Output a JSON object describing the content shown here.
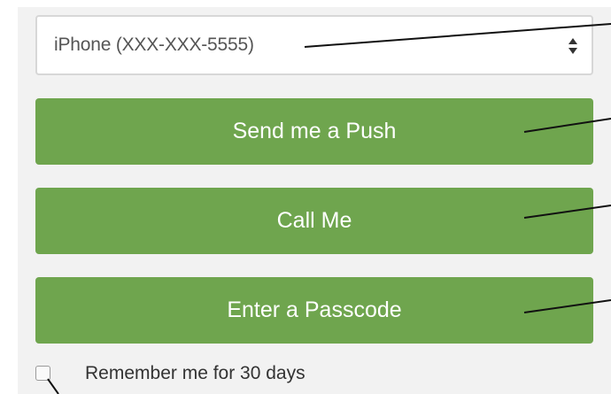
{
  "device_select": {
    "selected": "iPhone (XXX-XXX-5555)"
  },
  "buttons": {
    "push": "Send me a Push",
    "call": "Call Me",
    "passcode": "Enter a Passcode"
  },
  "remember": {
    "label": "Remember me for 30 days",
    "checked": false
  },
  "colors": {
    "button_green": "#6fa54e",
    "panel_background": "#f2f2f2"
  }
}
